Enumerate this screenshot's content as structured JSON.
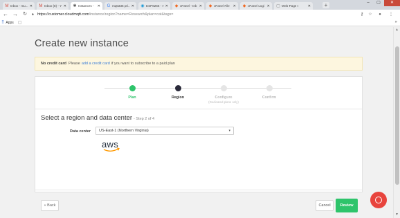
{
  "browser": {
    "tabs": [
      {
        "icon": "M",
        "label": "Inbox - mu...",
        "active": false
      },
      {
        "icon": "M",
        "label": "Inbox (8) - Y",
        "active": false
      },
      {
        "icon": "✱",
        "label": "Instances -",
        "active": true
      },
      {
        "icon": "G",
        "label": "mqtt336 pri...",
        "active": false
      },
      {
        "icon": "◉",
        "label": "ESP8266 - H",
        "active": false
      },
      {
        "icon": "◆",
        "label": "cPanel - Inb",
        "active": false
      },
      {
        "icon": "◆",
        "label": "cPanel File",
        "active": false
      },
      {
        "icon": "◆",
        "label": "cPanel Logi",
        "active": false
      },
      {
        "icon": "▢",
        "label": "Web Page t",
        "active": false
      }
    ],
    "url_host": "https://customer.cloudmqtt.com",
    "url_path": "/instance/region?name=Research&plan=cat&tags=",
    "bookmarks_apps": "Apps"
  },
  "page": {
    "title": "Create new instance",
    "notice_bold": "No credit card",
    "notice_pre": "Please",
    "notice_link": "add a credit card",
    "notice_post": "if you want to subscribe to a paid plan",
    "steps": [
      {
        "label": "Plan",
        "state": "done",
        "sub": ""
      },
      {
        "label": "Region",
        "state": "current",
        "sub": ""
      },
      {
        "label": "Configure",
        "state": "todo",
        "sub": "(Dedicated plans only)"
      },
      {
        "label": "Confirm",
        "state": "todo",
        "sub": ""
      }
    ],
    "section_title": "Select a region and data center",
    "section_sub": "- Step 2 of 4",
    "field_label": "Data center",
    "select_value": "US-East-1 (Northern Virginia)",
    "provider_logo": "aws",
    "back_label": "« Back",
    "cancel_label": "Cancel",
    "review_label": "Review"
  }
}
